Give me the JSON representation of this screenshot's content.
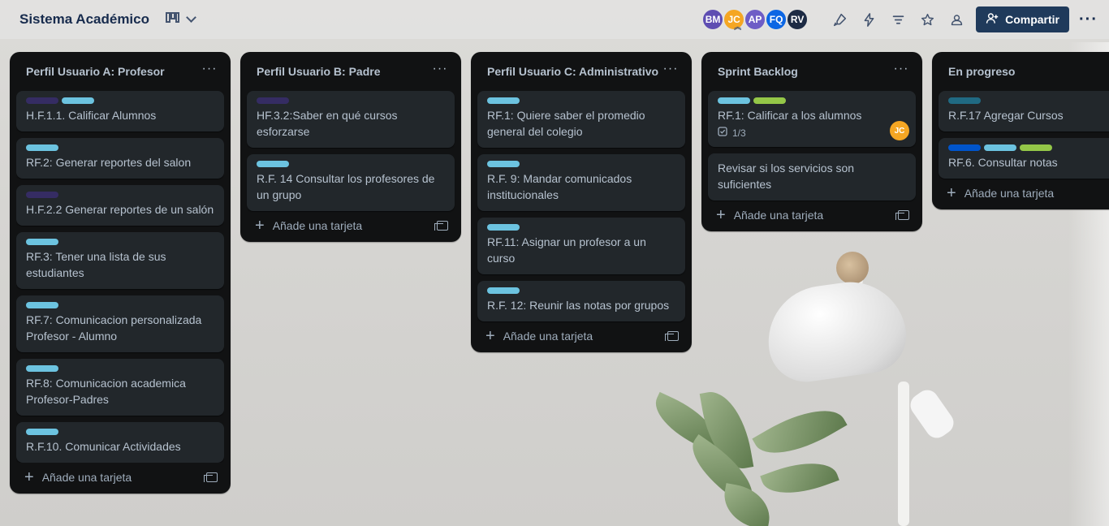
{
  "board": {
    "title": "Sistema Académico",
    "share_label": "Compartir"
  },
  "members": [
    {
      "initials": "BM",
      "color": "#5e4db2"
    },
    {
      "initials": "JC",
      "color": "#f5a623"
    },
    {
      "initials": "AP",
      "color": "#6e5dc6"
    },
    {
      "initials": "FQ",
      "color": "#0c66e4"
    },
    {
      "initials": "RV",
      "color": "#1d2b44"
    }
  ],
  "label_colors": {
    "purple": "#352c63",
    "cyan": "#6cc3e0",
    "lime": "#94c748",
    "teal": "#206a83",
    "blue": "#0055cc"
  },
  "add_card_label": "Añade una tarjeta",
  "lists": [
    {
      "title": "Perfil Usuario A: Profesor",
      "cards": [
        {
          "labels": [
            "purple",
            "cyan"
          ],
          "text": "H.F.1.1. Calificar Alumnos"
        },
        {
          "labels": [
            "cyan"
          ],
          "text": "RF.2: Generar reportes del salon"
        },
        {
          "labels": [
            "purple"
          ],
          "text": "H.F.2.2 Generar reportes de un salón"
        },
        {
          "labels": [
            "cyan"
          ],
          "text": "RF.3: Tener una lista de sus estudiantes"
        },
        {
          "labels": [
            "cyan"
          ],
          "text": "RF.7: Comunicacion personalizada Profesor - Alumno"
        },
        {
          "labels": [
            "cyan"
          ],
          "text": "RF.8: Comunicacion academica Profesor-Padres"
        },
        {
          "labels": [
            "cyan"
          ],
          "text": "R.F.10. Comunicar Actividades"
        }
      ]
    },
    {
      "title": "Perfil Usuario B: Padre",
      "cards": [
        {
          "labels": [
            "purple"
          ],
          "text": "HF.3.2:Saber en qué cursos esforzarse"
        },
        {
          "labels": [
            "cyan"
          ],
          "text": "R.F. 14 Consultar los profesores de un grupo"
        }
      ]
    },
    {
      "title": "Perfil Usuario C: Administrativo",
      "cards": [
        {
          "labels": [
            "cyan"
          ],
          "text": "RF.1: Quiere saber el promedio general del colegio"
        },
        {
          "labels": [
            "cyan"
          ],
          "text": "R.F. 9: Mandar comunicados institucionales"
        },
        {
          "labels": [
            "cyan"
          ],
          "text": "RF.11: Asignar un profesor a un curso"
        },
        {
          "labels": [
            "cyan"
          ],
          "text": "R.F. 12: Reunir las notas por grupos"
        }
      ]
    },
    {
      "title": "Sprint Backlog",
      "cards": [
        {
          "labels": [
            "cyan",
            "lime"
          ],
          "text": "RF.1: Calificar a los alumnos",
          "checklist": "1/3",
          "member": "JC"
        },
        {
          "labels": [],
          "text": "Revisar si los servicios son suficientes"
        }
      ]
    },
    {
      "title": "En progreso",
      "cards": [
        {
          "labels": [
            "teal"
          ],
          "text": "R.F.17 Agregar Cursos"
        },
        {
          "labels": [
            "blue",
            "cyan",
            "lime"
          ],
          "text": "RF.6. Consultar notas"
        }
      ]
    }
  ]
}
